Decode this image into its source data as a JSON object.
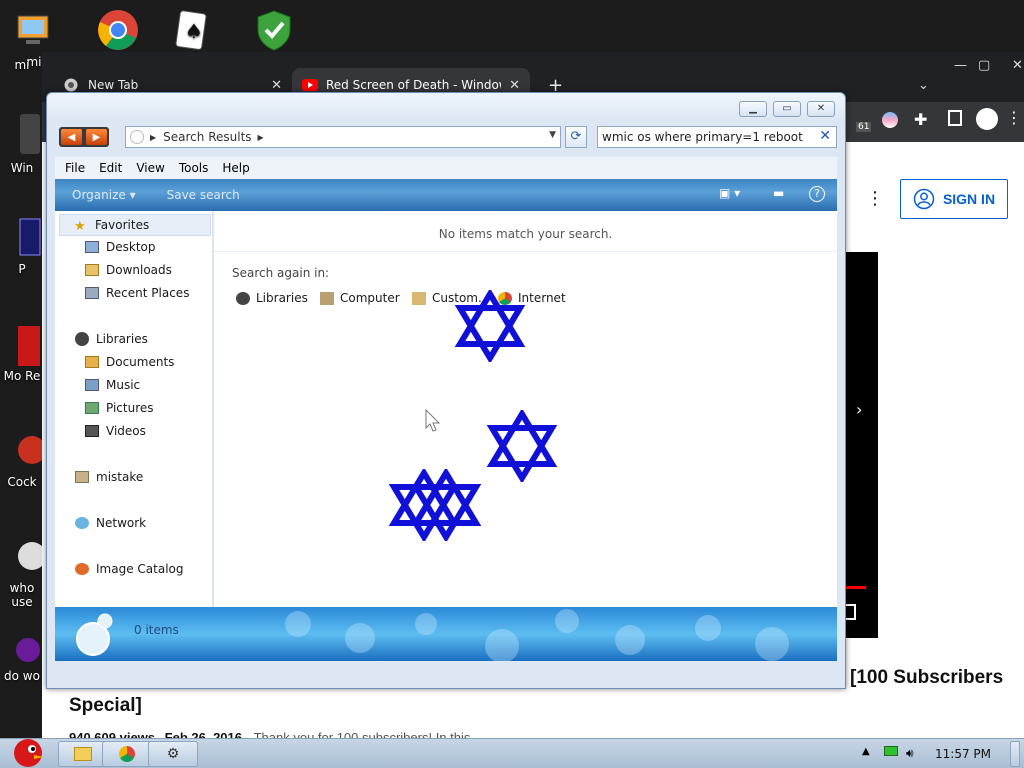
{
  "desktop": {
    "icons": [
      {
        "label": "mi",
        "icon": "computer-icon"
      },
      {
        "label": "",
        "icon": "chrome-icon"
      },
      {
        "label": "",
        "icon": "solitaire-icon"
      },
      {
        "label": "",
        "icon": "security-shield-icon"
      },
      {
        "label": "Win",
        "icon": "recycle-bin-icon"
      },
      {
        "label": "P",
        "icon": "app-icon"
      },
      {
        "label": "Mo Re",
        "icon": "acrobat-icon"
      },
      {
        "label": "Cock",
        "icon": "game-icon"
      },
      {
        "label": "who use",
        "icon": "app-icon"
      },
      {
        "label": "do wo",
        "icon": "app-icon"
      }
    ]
  },
  "browser": {
    "tabs": [
      {
        "title": "New Tab",
        "close": "✕"
      },
      {
        "title": "Red Screen of Death - Window",
        "close": "✕"
      }
    ],
    "new_tab": "+",
    "toolbar_badge": "61",
    "youtube": {
      "sign_in": "SIGN IN",
      "title_part1": "[100 Subscribers",
      "title_part2": "Special]",
      "views": "940,609 views",
      "date": "Feb 26, 2016",
      "description": "Thank you for 100 subscribers! In this"
    }
  },
  "explorer": {
    "address": {
      "label": "Search Results"
    },
    "search": {
      "value": "wmic os where primary=1 reboot"
    },
    "menu": [
      "File",
      "Edit",
      "View",
      "Tools",
      "Help"
    ],
    "commands": {
      "organize": "Organize",
      "save_search": "Save search"
    },
    "nav": {
      "favorites": "Favorites",
      "desktop": "Desktop",
      "downloads": "Downloads",
      "recent": "Recent Places",
      "libraries": "Libraries",
      "documents": "Documents",
      "music": "Music",
      "pictures": "Pictures",
      "videos": "Videos",
      "mistake": "mistake",
      "network": "Network",
      "image_catalog": "Image Catalog"
    },
    "content": {
      "no_items": "No items match your search.",
      "search_again": "Search again in:",
      "locations": [
        "Libraries",
        "Computer",
        "Custom...",
        "Internet"
      ]
    },
    "details": {
      "count": "0 items"
    }
  },
  "taskbar": {
    "clock": "11:57 PM"
  },
  "colors": {
    "star": "#1010d8",
    "cmdbar": "#3c84c4",
    "youtube_blue": "#065fd4"
  }
}
